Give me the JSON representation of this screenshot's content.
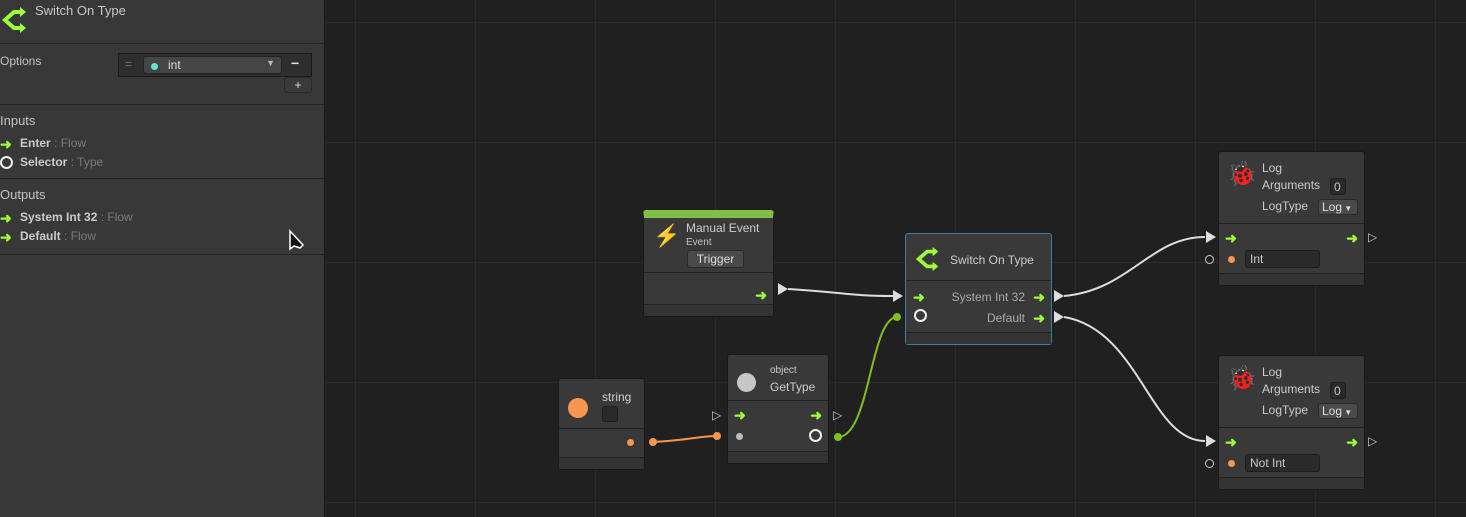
{
  "inspector": {
    "title": "Switch On Type",
    "options_label": "Options",
    "option_value": "int",
    "remove_label": "−",
    "add_label": "+",
    "inputs_label": "Inputs",
    "inputs": [
      {
        "name": "Enter",
        "type": ": Flow"
      },
      {
        "name": "Selector",
        "type": ": Type"
      }
    ],
    "outputs_label": "Outputs",
    "outputs": [
      {
        "name": "System Int 32",
        "type": ": Flow"
      },
      {
        "name": "Default",
        "type": ": Flow"
      }
    ]
  },
  "nodes": {
    "manual_event": {
      "title": "Manual Event",
      "subtitle": "Event",
      "button": "Trigger"
    },
    "switch": {
      "title": "Switch On Type",
      "out1": "System Int 32",
      "out2": "Default"
    },
    "string": {
      "title": "string"
    },
    "gettype": {
      "subtitle": "object",
      "title": "GetType"
    },
    "log1": {
      "title": "Log",
      "arguments_label": "Arguments",
      "arguments": "0",
      "logtype_label": "LogType",
      "logtype": "Log",
      "message": "Int"
    },
    "log2": {
      "title": "Log",
      "arguments_label": "Arguments",
      "arguments": "0",
      "logtype_label": "LogType",
      "logtype": "Log",
      "message": "Not Int"
    }
  },
  "colors": {
    "flow": "#9bff3a",
    "string": "#f7964f",
    "type": "#7fc01f",
    "selection": "#3a7fa8"
  }
}
